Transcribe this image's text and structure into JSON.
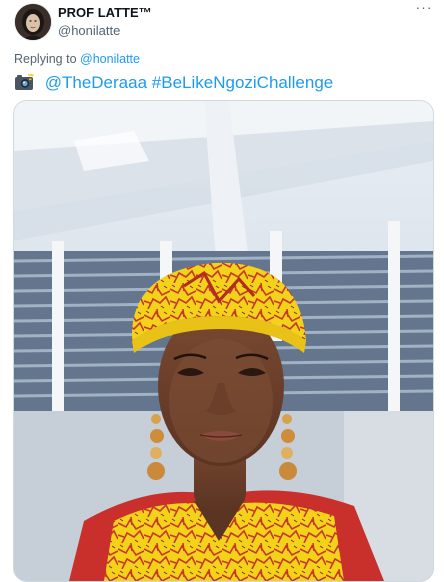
{
  "author": {
    "display_name": "PROF LATTE™",
    "handle": "@honilatte",
    "avatar_icon": "profile-avatar"
  },
  "more_icon": "ellipsis-icon",
  "reply": {
    "prefix": "Replying to",
    "target": "@honilatte"
  },
  "tweet": {
    "camera_icon": "camera-flash-icon",
    "mention": "@TheDeraaa",
    "hashtag": "#BeLikeNgoziChallenge"
  },
  "media": {
    "description_icon": "photo-icon"
  },
  "colors": {
    "accent": "#1d9bf0",
    "text_primary": "#0f1419",
    "text_secondary": "#536471",
    "border": "#cfd9de"
  }
}
